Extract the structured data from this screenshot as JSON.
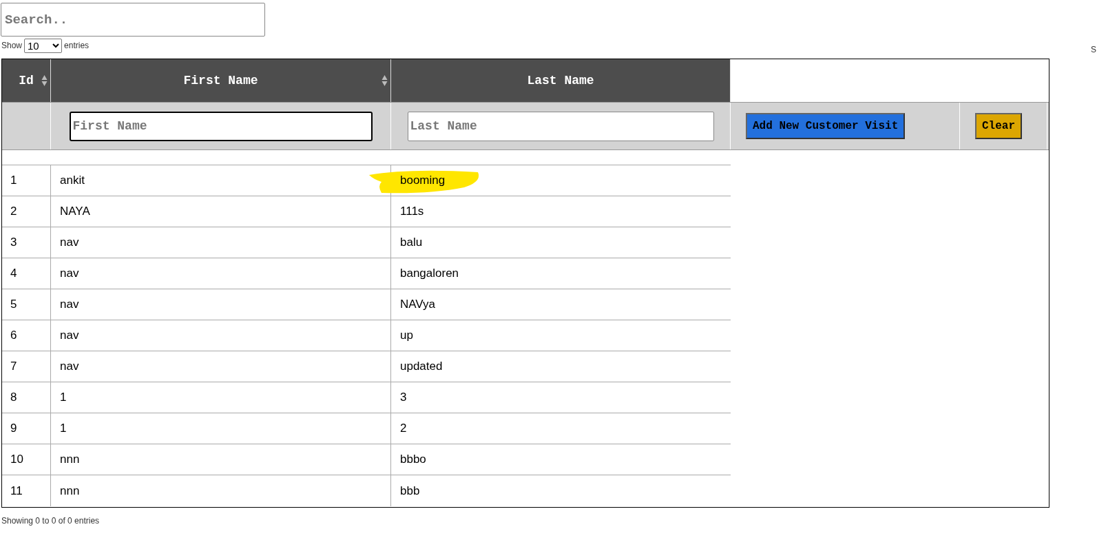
{
  "search": {
    "placeholder": "Search.."
  },
  "length": {
    "before": "Show",
    "value": "10",
    "after": "entries"
  },
  "edge_text": "S",
  "table": {
    "columns": [
      {
        "label": "Id",
        "sortable": true
      },
      {
        "label": "First Name",
        "sortable": true
      },
      {
        "label": "Last Name",
        "sortable": false
      }
    ],
    "filters": {
      "first_name": {
        "placeholder": "First Name"
      },
      "last_name": {
        "placeholder": "Last Name"
      }
    },
    "buttons": [
      {
        "label": "Add New Customer Visit",
        "kind": "primary"
      },
      {
        "label": "Clear",
        "kind": "warning"
      }
    ],
    "rows": [
      {
        "id": "1",
        "first_name": "ankit",
        "last_name": "booming",
        "highlighted": true
      },
      {
        "id": "2",
        "first_name": "NAYA",
        "last_name": "111s",
        "highlighted": false
      },
      {
        "id": "3",
        "first_name": "nav",
        "last_name": "balu",
        "highlighted": false
      },
      {
        "id": "4",
        "first_name": "nav",
        "last_name": "bangaloren",
        "highlighted": false
      },
      {
        "id": "5",
        "first_name": "nav",
        "last_name": "NAVya",
        "highlighted": false
      },
      {
        "id": "6",
        "first_name": "nav",
        "last_name": "up",
        "highlighted": false
      },
      {
        "id": "7",
        "first_name": "nav",
        "last_name": "updated",
        "highlighted": false
      },
      {
        "id": "8",
        "first_name": "1",
        "last_name": "3",
        "highlighted": false
      },
      {
        "id": "9",
        "first_name": "1",
        "last_name": "2",
        "highlighted": false
      },
      {
        "id": "10",
        "first_name": "nnn",
        "last_name": "bbbo",
        "highlighted": false
      },
      {
        "id": "11",
        "first_name": "nnn",
        "last_name": "bbb",
        "highlighted": false
      }
    ]
  },
  "info": "Showing 0 to 0 of 0 entries"
}
